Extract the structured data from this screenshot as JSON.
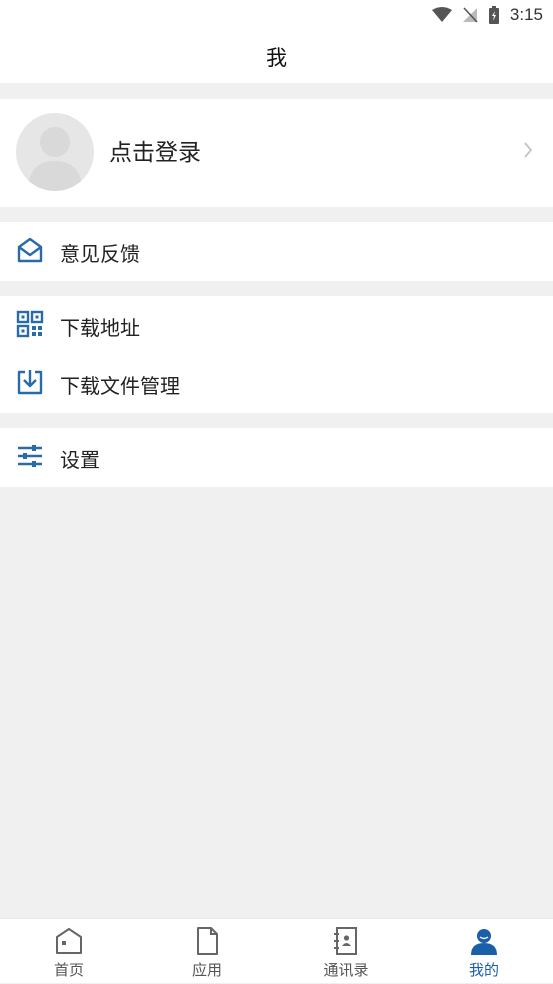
{
  "status_bar": {
    "time": "3:15"
  },
  "header": {
    "title": "我"
  },
  "login": {
    "label": "点击登录"
  },
  "menu": {
    "feedback": "意见反馈",
    "download_url": "下载地址",
    "download_files": "下载文件管理",
    "settings": "设置"
  },
  "tabs": [
    {
      "label": "首页",
      "icon": "home-icon"
    },
    {
      "label": "应用",
      "icon": "document-icon"
    },
    {
      "label": "通讯录",
      "icon": "contacts-icon"
    },
    {
      "label": "我的",
      "icon": "user-icon",
      "active": true
    }
  ],
  "colors": {
    "accent": "#1a5fa8",
    "icon_blue": "#2a6aa8",
    "background": "#f0f0f0"
  }
}
